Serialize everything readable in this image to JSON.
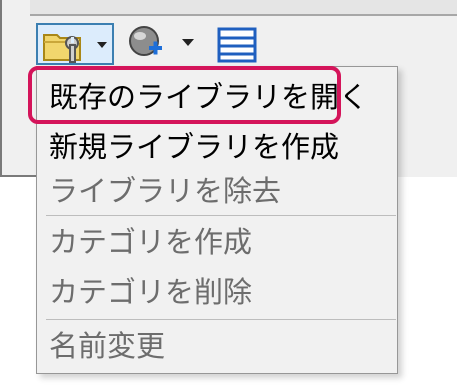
{
  "toolbar": {
    "library_button": {
      "icon": "folder-wrench-icon",
      "dropdown": "dropdown-arrow-icon"
    },
    "globe_button": {
      "icon": "globe-add-icon",
      "dropdown": "dropdown-arrow-icon"
    },
    "list_button": {
      "icon": "list-view-icon"
    }
  },
  "menu": {
    "items": [
      {
        "label": "既存のライブラリを開く",
        "enabled": true,
        "highlighted": true
      },
      {
        "label": "新規ライブラリを作成",
        "enabled": true
      },
      {
        "label": "ライブラリを除去",
        "enabled": false
      },
      {
        "label": "カテゴリを作成",
        "enabled": false
      },
      {
        "label": "カテゴリを削除",
        "enabled": false
      },
      {
        "label": "名前変更",
        "enabled": false
      }
    ]
  },
  "colors": {
    "highlight_border": "#d4145a",
    "menu_background": "#f1f1f1",
    "disabled_text": "#6d6d6d",
    "button_selected": "#dcecfc"
  }
}
